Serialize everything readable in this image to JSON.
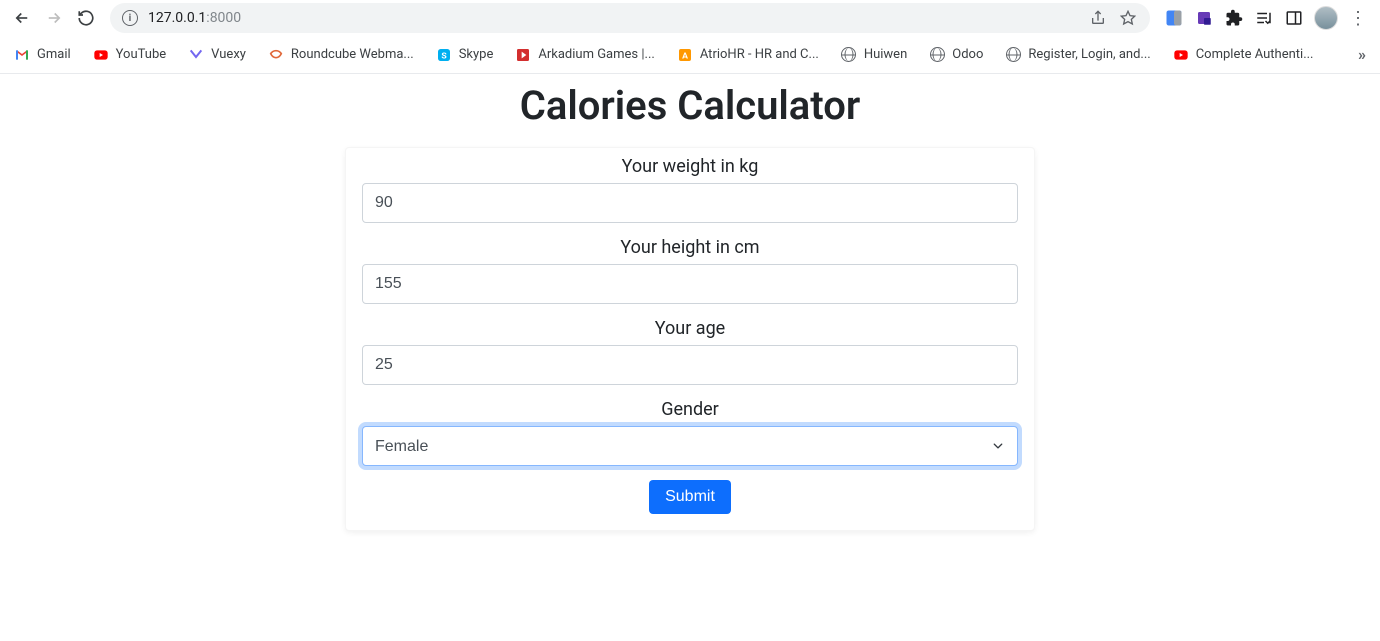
{
  "browser": {
    "url_host": "127.0.0.1",
    "url_port": ":8000"
  },
  "bookmarks": [
    {
      "label": "Gmail",
      "icon": "gmail"
    },
    {
      "label": "YouTube",
      "icon": "youtube"
    },
    {
      "label": "Vuexy",
      "icon": "vuexy"
    },
    {
      "label": "Roundcube Webma...",
      "icon": "roundcube"
    },
    {
      "label": "Skype",
      "icon": "skype"
    },
    {
      "label": "Arkadium Games |...",
      "icon": "arkadium"
    },
    {
      "label": "AtrioHR - HR and C...",
      "icon": "atriohr"
    },
    {
      "label": "Huiwen",
      "icon": "globe"
    },
    {
      "label": "Odoo",
      "icon": "globe"
    },
    {
      "label": "Register, Login, and...",
      "icon": "globe"
    },
    {
      "label": "Complete Authenti...",
      "icon": "youtube"
    }
  ],
  "page": {
    "title": "Calories Calculator",
    "form": {
      "weight_label": "Your weight in kg",
      "weight_value": "90",
      "height_label": "Your height in cm",
      "height_value": "155",
      "age_label": "Your age",
      "age_value": "25",
      "gender_label": "Gender",
      "gender_selected": "Female",
      "submit_label": "Submit"
    }
  }
}
